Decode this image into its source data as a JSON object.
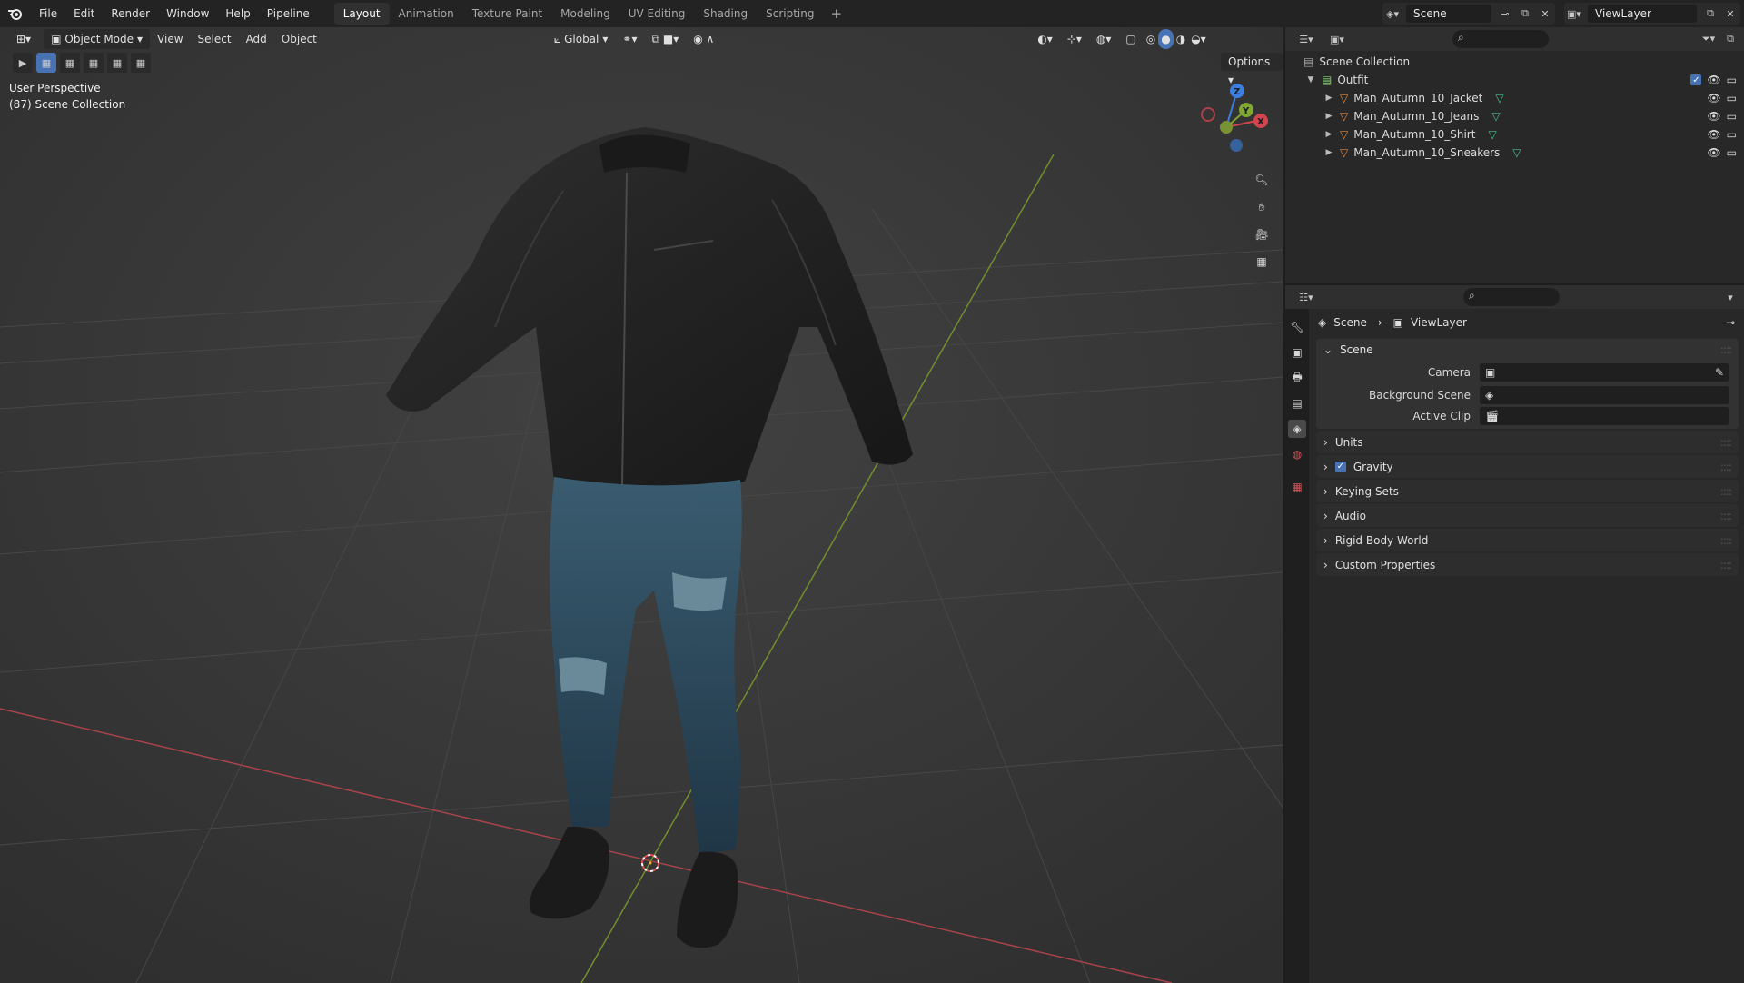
{
  "topbar": {
    "menus": [
      "File",
      "Edit",
      "Render",
      "Window",
      "Help",
      "Pipeline"
    ],
    "workspace_tabs": [
      "Layout",
      "Animation",
      "Texture Paint",
      "Modeling",
      "UV Editing",
      "Shading",
      "Scripting"
    ],
    "active_tab": "Layout",
    "add_tab": "+",
    "scene_name": "Scene",
    "view_layer": "ViewLayer"
  },
  "viewport": {
    "mode": "Object Mode",
    "menus": [
      "View",
      "Select",
      "Add",
      "Object"
    ],
    "orientation": "Global",
    "options_label": "Options",
    "overlay_line1": "User Perspective",
    "overlay_line2": "(87) Scene Collection",
    "gizmo_axes": {
      "x": "X",
      "y": "Y",
      "z": "Z"
    },
    "colors": {
      "x_axis": "#d2444e",
      "y_axis": "#7fa732",
      "z_axis": "#3c7fe0",
      "background": "#3a3a3a"
    }
  },
  "outliner": {
    "root": "Scene Collection",
    "collection": "Outfit",
    "objects": [
      {
        "name": "Man_Autumn_10_Jacket"
      },
      {
        "name": "Man_Autumn_10_Jeans"
      },
      {
        "name": "Man_Autumn_10_Shirt"
      },
      {
        "name": "Man_Autumn_10_Sneakers"
      }
    ]
  },
  "properties": {
    "breadcrumb_scene": "Scene",
    "breadcrumb_viewlayer": "ViewLayer",
    "scene_panel": "Scene",
    "camera_label": "Camera",
    "background_scene_label": "Background Scene",
    "active_clip_label": "Active Clip",
    "panels": [
      "Units",
      "Gravity",
      "Keying Sets",
      "Audio",
      "Rigid Body World",
      "Custom Properties"
    ],
    "gravity_checked": true
  }
}
